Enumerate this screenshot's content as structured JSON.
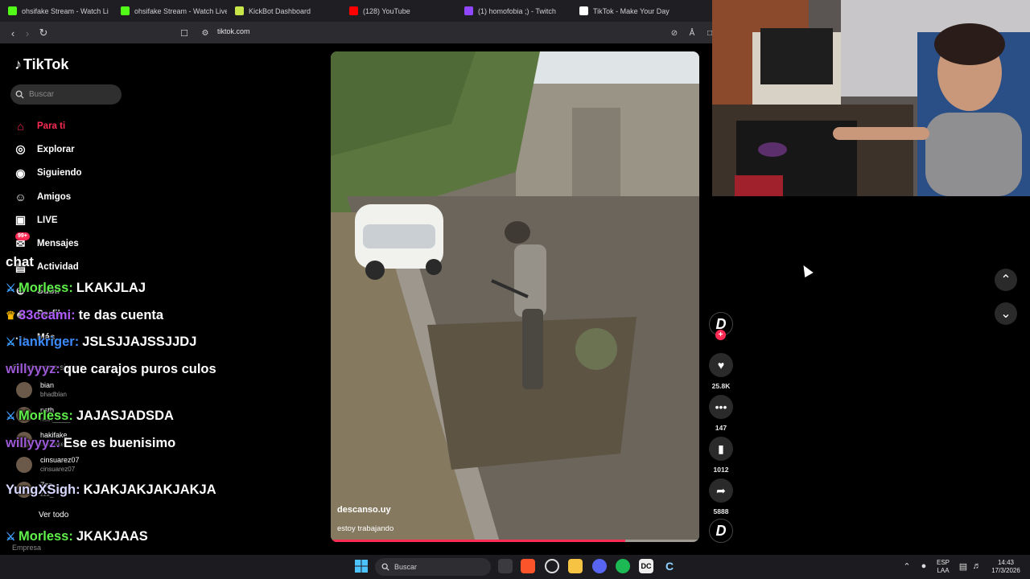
{
  "browser": {
    "tabs": [
      {
        "title": "ohsifake Stream - Watch Li",
        "icon": "kick-icon",
        "color": "#53fc18"
      },
      {
        "title": "ohsifake Stream - Watch Live o",
        "icon": "kick-icon",
        "color": "#53fc18"
      },
      {
        "title": "KickBot Dashboard",
        "icon": "kickbot-icon",
        "color": "#c8e64a"
      },
      {
        "title": "(128) YouTube",
        "icon": "youtube-icon",
        "color": "#ff0000"
      },
      {
        "title": "(1) homofobia ;) - Twitch",
        "icon": "twitch-icon",
        "color": "#9146ff"
      },
      {
        "title": "TikTok - Make Your Day",
        "icon": "tiktok-icon",
        "color": "#ffffff"
      }
    ],
    "url": "tiktok.com"
  },
  "tiktok": {
    "logo": "TikTok",
    "search_placeholder": "Buscar",
    "nav": [
      {
        "label": "Para ti",
        "icon": "home-icon",
        "active": true
      },
      {
        "label": "Explorar",
        "icon": "compass-icon"
      },
      {
        "label": "Siguiendo",
        "icon": "following-icon"
      },
      {
        "label": "Amigos",
        "icon": "friends-icon"
      },
      {
        "label": "LIVE",
        "icon": "live-icon"
      },
      {
        "label": "Mensajes",
        "icon": "messages-icon",
        "badge": "99+"
      },
      {
        "label": "Actividad",
        "icon": "activity-icon"
      },
      {
        "label": "Subir",
        "icon": "upload-icon"
      },
      {
        "label": "Perfil",
        "icon": "profile-icon"
      },
      {
        "label": "Más",
        "icon": "more-icon"
      }
    ],
    "following_title": "Cuentas que sigues",
    "accounts": [
      {
        "name": "bian",
        "handle": "bhadblan"
      },
      {
        "name": "nsth",
        "handle": "nsth_____"
      },
      {
        "name": "hakifake",
        "handle": "hakifake"
      },
      {
        "name": "cinsuarez07",
        "handle": "cinsuarez07"
      },
      {
        "name": "Zzz",
        "handle": "zzz_"
      }
    ],
    "see_all": "Ver todo",
    "footer": "Empresa",
    "video": {
      "author": "descanso.uy",
      "caption": "estoy trabajando",
      "progress": 0.8
    },
    "actions": {
      "likes": "25.8K",
      "comments": "147",
      "saves": "1012",
      "shares": "5888"
    }
  },
  "chat": {
    "title": "chat",
    "messages": [
      {
        "user": "Morless:",
        "text": "LKAKJLAJ",
        "color": "#5ff04a",
        "badge": "sword"
      },
      {
        "user": "33ccami:",
        "text": "te das cuenta",
        "color": "#b05cff",
        "badge": "crown"
      },
      {
        "user": "iankriger:",
        "text": "JSLSJJAJSSJJDJ",
        "color": "#3b8bff",
        "badge": "sword"
      },
      {
        "user": "willyyyz:",
        "text": "que carajos puros culos",
        "color": "#9b59d6",
        "badge": ""
      },
      {
        "user": "Morless:",
        "text": "JAJASJADSDA",
        "color": "#5ff04a",
        "badge": "sword"
      },
      {
        "user": "willyyyz:",
        "text": "Ese es buenisimo",
        "color": "#9b59d6",
        "badge": ""
      },
      {
        "user": "YungXSigh:",
        "text": "KJAKJAKJAKJAKJA",
        "color": "#d8d8ff",
        "badge": ""
      },
      {
        "user": "Morless:",
        "text": "JKAKJAAS",
        "color": "#5ff04a",
        "badge": "sword"
      },
      {
        "user": "Morless:",
        "text": "??",
        "color": "#5ff04a",
        "badge": "sword"
      }
    ]
  },
  "taskbar": {
    "search": "Buscar",
    "lang": "ESP",
    "lang2": "LAA",
    "time": "14:43",
    "date": "17/3/2026"
  }
}
